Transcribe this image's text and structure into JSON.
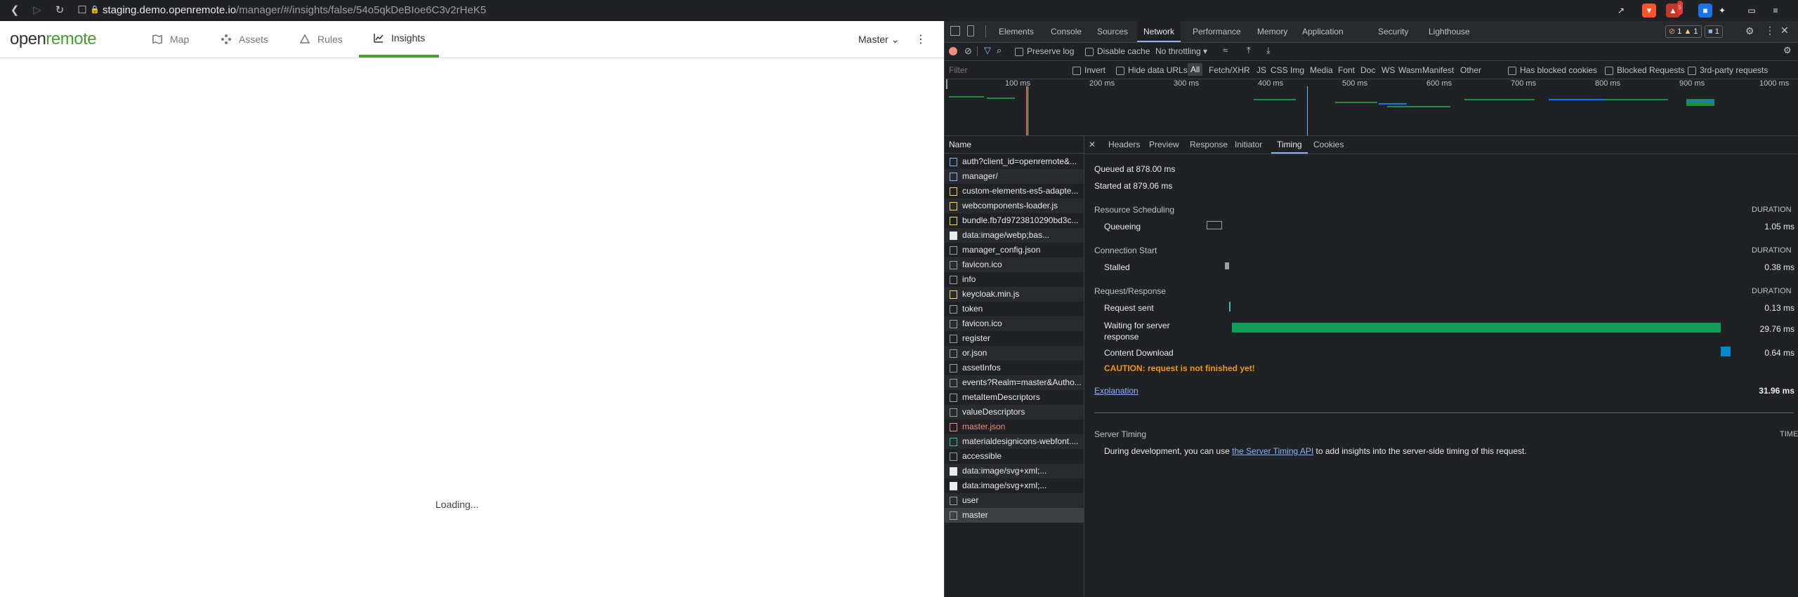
{
  "browser": {
    "url_host": "staging.demo.openremote.io",
    "url_path": "/manager/#/insights/false/54o5qkDeBIoe6C3v2rHeK5",
    "badge_count": "5"
  },
  "app": {
    "logo_open": "open",
    "logo_remote": "remote",
    "nav": [
      {
        "label": "Map",
        "icon": "map-icon"
      },
      {
        "label": "Assets",
        "icon": "assets-icon"
      },
      {
        "label": "Rules",
        "icon": "rules-icon"
      },
      {
        "label": "Insights",
        "icon": "insights-icon"
      }
    ],
    "realm": "Master",
    "loading": "Loading...",
    "accent": "#4b9b34"
  },
  "devtools": {
    "tabs": [
      "Elements",
      "Console",
      "Sources",
      "Network",
      "Performance",
      "Memory",
      "Application",
      "Security",
      "Lighthouse"
    ],
    "active_tab": "Network",
    "errors": "1",
    "warnings": "1",
    "messages": "1",
    "toolbar": {
      "preserve_log": "Preserve log",
      "disable_cache": "Disable cache",
      "throttling": "No throttling"
    },
    "filter": {
      "placeholder": "Filter",
      "invert": "Invert",
      "hide_data_urls": "Hide data URLs",
      "types": [
        "All",
        "Fetch/XHR",
        "JS",
        "CSS",
        "Img",
        "Media",
        "Font",
        "Doc",
        "WS",
        "Wasm",
        "Manifest",
        "Other"
      ],
      "has_blocked_cookies": "Has blocked cookies",
      "blocked_requests": "Blocked Requests",
      "third_party": "3rd-party requests"
    },
    "overview_ticks": [
      "100 ms",
      "200 ms",
      "300 ms",
      "400 ms",
      "500 ms",
      "600 ms",
      "700 ms",
      "800 ms",
      "900 ms",
      "1000 ms"
    ],
    "name_header": "Name",
    "requests": [
      {
        "name": "auth?client_id=openremote&...",
        "kind": "doc"
      },
      {
        "name": "manager/",
        "kind": "doc"
      },
      {
        "name": "custom-elements-es5-adapte...",
        "kind": "js"
      },
      {
        "name": "webcomponents-loader.js",
        "kind": "js"
      },
      {
        "name": "bundle.fb7d9723810290bd3c...",
        "kind": "js"
      },
      {
        "name": "data:image/webp;bas...",
        "kind": "img"
      },
      {
        "name": "manager_config.json",
        "kind": "other"
      },
      {
        "name": "favicon.ico",
        "kind": "other"
      },
      {
        "name": "info",
        "kind": "other"
      },
      {
        "name": "keycloak.min.js",
        "kind": "js"
      },
      {
        "name": "token",
        "kind": "other"
      },
      {
        "name": "favicon.ico",
        "kind": "other"
      },
      {
        "name": "register",
        "kind": "other"
      },
      {
        "name": "or.json",
        "kind": "other"
      },
      {
        "name": "assetInfos",
        "kind": "other"
      },
      {
        "name": "events?Realm=master&Autho...",
        "kind": "other"
      },
      {
        "name": "metaItemDescriptors",
        "kind": "other"
      },
      {
        "name": "valueDescriptors",
        "kind": "other"
      },
      {
        "name": "master.json",
        "kind": "error"
      },
      {
        "name": "materialdesignicons-webfont....",
        "kind": "font"
      },
      {
        "name": "accessible",
        "kind": "other"
      },
      {
        "name": "data:image/svg+xml;...",
        "kind": "img"
      },
      {
        "name": "data:image/svg+xml;...",
        "kind": "img"
      },
      {
        "name": "user",
        "kind": "other"
      },
      {
        "name": "master",
        "kind": "selected"
      }
    ],
    "detail_tabs": [
      "Headers",
      "Preview",
      "Response",
      "Initiator",
      "Timing",
      "Cookies"
    ],
    "active_detail_tab": "Timing",
    "timing": {
      "queued": "Queued at 878.00 ms",
      "started": "Started at 879.06 ms",
      "duration_label": "DURATION",
      "sections": [
        {
          "title": "Resource Scheduling",
          "rows": [
            {
              "label": "Queueing",
              "value": "1.05 ms"
            }
          ]
        },
        {
          "title": "Connection Start",
          "rows": [
            {
              "label": "Stalled",
              "value": "0.38 ms"
            }
          ]
        },
        {
          "title": "Request/Response",
          "rows": [
            {
              "label": "Request sent",
              "value": "0.13 ms"
            },
            {
              "label": "Waiting for server response",
              "value": "29.76 ms"
            },
            {
              "label": "Content Download",
              "value": "0.64 ms"
            }
          ]
        }
      ],
      "caution": "CAUTION: request is not finished yet!",
      "explanation": "Explanation",
      "total": "31.96 ms",
      "server_timing_title": "Server Timing",
      "time_label": "TIME",
      "server_timing_pre": "During development, you can use",
      "server_timing_link": "the Server Timing API",
      "server_timing_post": "to add insights into the server-side timing of this request."
    }
  }
}
